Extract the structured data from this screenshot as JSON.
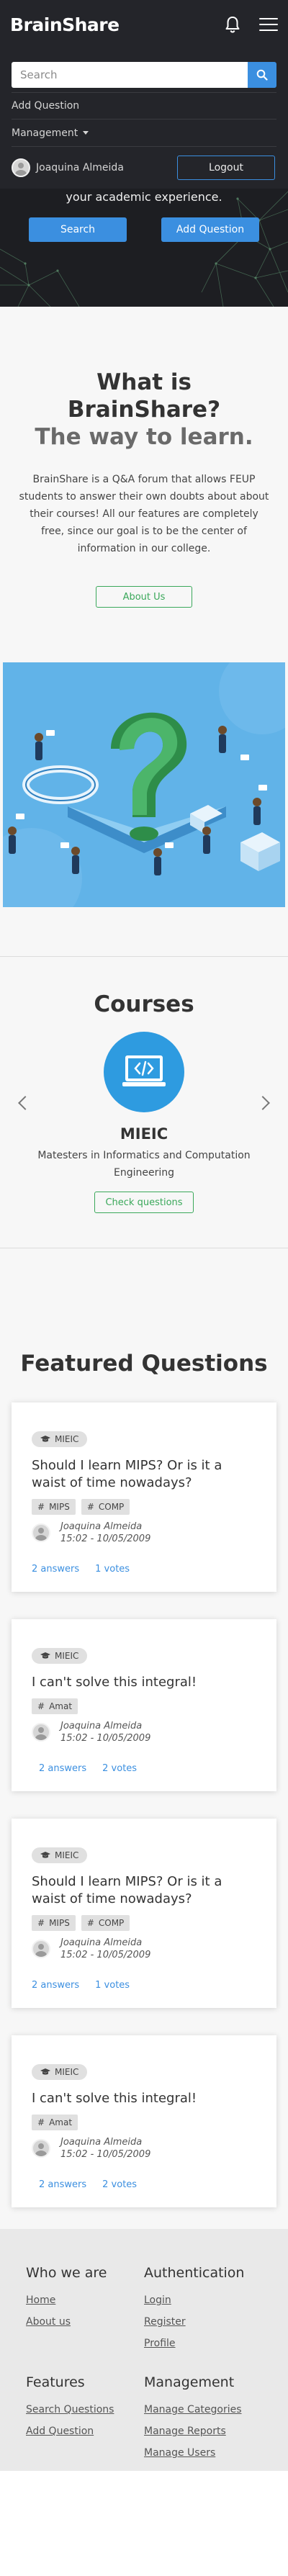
{
  "navbar": {
    "brand": "BrainShare",
    "search_placeholder": "Search",
    "add_question": "Add Question",
    "management": "Management",
    "username": "Joaquina Almeida",
    "logout": "Logout"
  },
  "hero": {
    "text": "your academic experience.",
    "search_button": "Search",
    "add_question_button": "Add Question"
  },
  "about": {
    "title": "What is BrainShare?",
    "subtitle": "The way to learn.",
    "description": "BrainShare is a Q&A forum that allows FEUP students to answer their own doubts about about their courses! All our features are completely free, since our goal is to be the center of information in our college.",
    "button": "About Us"
  },
  "courses": {
    "title": "Courses",
    "items": [
      {
        "name": "MIEIC",
        "description": "Matesters in Informatics and Computation Engineering",
        "button": "Check questions"
      }
    ]
  },
  "featured": {
    "title": "Featured Questions",
    "questions": [
      {
        "course": "MIEIC",
        "title": "Should I learn MIPS? Or is it a waist of time nowadays?",
        "tags": [
          "MIPS",
          "COMP"
        ],
        "author": "Joaquina Almeida",
        "date": "15:02 - 10/05/2009",
        "answers": "2 answers",
        "votes": "1 votes"
      },
      {
        "course": "MIEIC",
        "title": "I can't solve this integral!",
        "tags": [
          "Amat"
        ],
        "author": "Joaquina Almeida",
        "date": "15:02 - 10/05/2009",
        "answers": "2 answers",
        "votes": "2 votes"
      },
      {
        "course": "MIEIC",
        "title": "Should I learn MIPS? Or is it a waist of time nowadays?",
        "tags": [
          "MIPS",
          "COMP"
        ],
        "author": "Joaquina Almeida",
        "date": "15:02 - 10/05/2009",
        "answers": "2 answers",
        "votes": "1 votes"
      },
      {
        "course": "MIEIC",
        "title": "I can't solve this integral!",
        "tags": [
          "Amat"
        ],
        "author": "Joaquina Almeida",
        "date": "15:02 - 10/05/2009",
        "answers": "2 answers",
        "votes": "2 votes"
      }
    ]
  },
  "footer": {
    "who_we_are": {
      "title": "Who we are",
      "links": [
        "Home",
        "About us"
      ]
    },
    "authentication": {
      "title": "Authentication",
      "links": [
        "Login",
        "Register",
        "Profile"
      ]
    },
    "features": {
      "title": "Features",
      "links": [
        "Search Questions",
        "Add Question"
      ]
    },
    "management": {
      "title": "Management",
      "links": [
        "Manage Categories",
        "Manage Reports",
        "Manage Users"
      ]
    }
  },
  "colors": {
    "accent": "#3b8fe0",
    "success": "#3aa85a",
    "nav": "#24252a"
  },
  "icons": [
    "bell-icon",
    "menu-icon",
    "search-icon",
    "graduation-cap-icon",
    "hashtag-icon",
    "code-icon",
    "chevron-left-icon",
    "chevron-right-icon"
  ]
}
